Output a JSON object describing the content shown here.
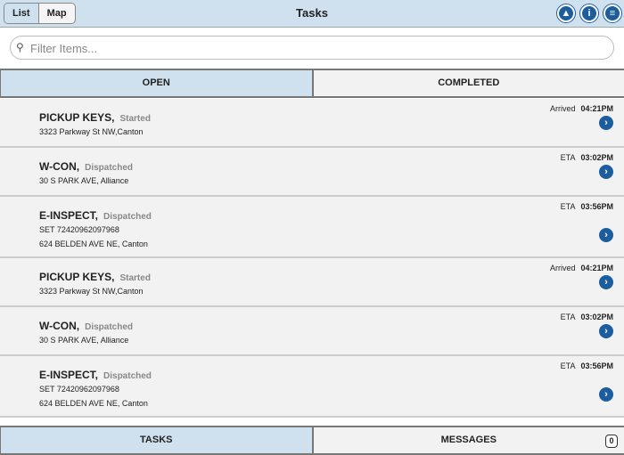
{
  "header": {
    "list_label": "List",
    "map_label": "Map",
    "title": "Tasks"
  },
  "search": {
    "placeholder": "Filter Items..."
  },
  "filter_tabs": {
    "open": "OPEN",
    "completed": "COMPLETED"
  },
  "tasks": [
    {
      "name": "PICKUP KEYS,",
      "status": "Started",
      "lines": [
        "3323 Parkway St NW,Canton"
      ],
      "time_label": "Arrived",
      "time": "04:21PM"
    },
    {
      "name": "W-CON,",
      "status": "Dispatched",
      "lines": [
        "30 S PARK AVE, Alliance"
      ],
      "time_label": "ETA",
      "time": "03:02PM"
    },
    {
      "name": "E-INSPECT,",
      "status": "Dispatched",
      "lines": [
        "SET 72420962097968",
        "624 BELDEN AVE NE, Canton"
      ],
      "time_label": "ETA",
      "time": "03:56PM"
    },
    {
      "name": "PICKUP KEYS,",
      "status": "Started",
      "lines": [
        "3323 Parkway St NW,Canton"
      ],
      "time_label": "Arrived",
      "time": "04:21PM"
    },
    {
      "name": "W-CON,",
      "status": "Dispatched",
      "lines": [
        "30 S PARK AVE, Alliance"
      ],
      "time_label": "ETA",
      "time": "03:02PM"
    },
    {
      "name": "E-INSPECT,",
      "status": "Dispatched",
      "lines": [
        "SET 72420962097968",
        "624 BELDEN AVE NE, Canton"
      ],
      "time_label": "ETA",
      "time": "03:56PM"
    }
  ],
  "bottom_tabs": {
    "tasks": "TASKS",
    "messages": "MESSAGES",
    "messages_count": "0"
  }
}
